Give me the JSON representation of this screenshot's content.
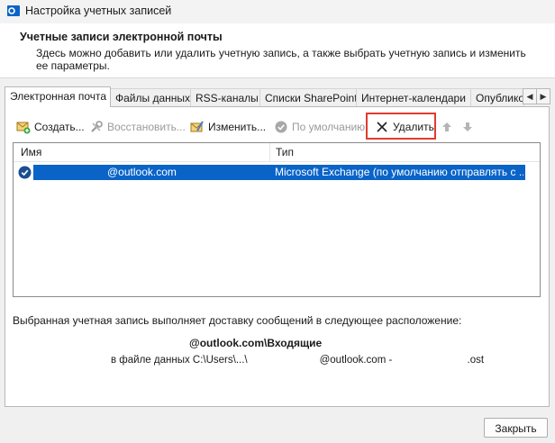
{
  "window": {
    "title": "Настройка учетных записей"
  },
  "header": {
    "title": "Учетные записи электронной почты",
    "description": "Здесь можно добавить или удалить учетную запись, а также выбрать учетную запись и изменить ее параметры."
  },
  "tabs": [
    {
      "label": "Электронная почта",
      "active": true
    },
    {
      "label": "Файлы данных",
      "active": false
    },
    {
      "label": "RSS-каналы",
      "active": false
    },
    {
      "label": "Списки SharePoint",
      "active": false
    },
    {
      "label": "Интернет-календари",
      "active": false
    },
    {
      "label": "Опублико",
      "active": false
    }
  ],
  "toolbar": {
    "create": "Создать...",
    "restore": "Восстановить...",
    "edit": "Изменить...",
    "default": "По умолчанию",
    "delete": "Удалить"
  },
  "list": {
    "columns": [
      "Имя",
      "Тип"
    ],
    "rows": [
      {
        "name": "@outlook.com",
        "type": "Microsoft Exchange (по умолчанию отправлять с ..."
      }
    ]
  },
  "delivery": {
    "label": "Выбранная учетная запись выполняет доставку сообщений в следующее расположение:",
    "folder": "@outlook.com\\Входящие",
    "file_prefix": "в файле данных C:\\Users\\...\\",
    "file_suffix": "@outlook.com - ",
    "file_ext": ".ost"
  },
  "buttons": {
    "close": "Закрыть"
  },
  "colors": {
    "selection": "#0a64c8",
    "highlight": "#e23b2e"
  }
}
